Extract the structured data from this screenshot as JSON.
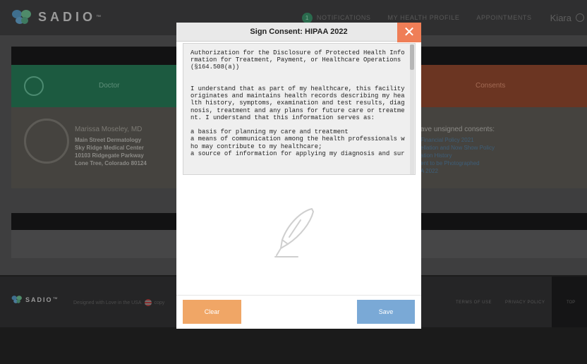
{
  "brand": {
    "name": "SADIO",
    "tm": "™"
  },
  "nav": {
    "notification_count": "1",
    "notifications": "NOTIFICATIONS",
    "health_profile": "MY HEALTH PROFILE",
    "appointments": "APPOINTMENTS",
    "user": "Kiara"
  },
  "cards": {
    "doctor_label": "Doctor",
    "consents_label": "Consents"
  },
  "doctor": {
    "name": "Marissa Moseley, MD",
    "practice": "Main Street Dermatology",
    "center": "Sky Ridge Medical Center",
    "street": "10103 Ridgegate Parkway",
    "city": "Lone Tree, Colorado 80124"
  },
  "consents": {
    "title": "ave unsigned consents:",
    "items": [
      "Financial Policy 2021",
      "ellation and Now Show Policy",
      "ation History",
      "ent to be Photographed",
      "A 2022"
    ]
  },
  "footer": {
    "designed": "Designed with Love in the USA",
    "copyright": "copy",
    "terms": "TERMS OF USE",
    "privacy": "PRIVACY POLICY",
    "top": "TOP"
  },
  "modal": {
    "title": "Sign Consent: HIPAA 2022",
    "close": "✕",
    "text": "Authorization for the Disclosure of Protected Health Information for Treatment, Payment, or Healthcare Operations (§164.508(a))\n\n\nI understand that as part of my healthcare, this facility originates and maintains health records describing my health history, symptoms, examination and test results, diagnosis, treatment and any plans for future care or treatment. I understand that this information serves as:\n\na basis for planning my care and treatment\na means of communication among the health professionals who may contribute to my healthcare;\na source of information for applying my diagnosis and sur",
    "clear": "Clear",
    "save": "Save"
  },
  "icons": {
    "logo": "sadio-logo-icon",
    "signature": "pen-icon",
    "close": "close-icon",
    "avatar": "avatar-icon"
  },
  "colors": {
    "close_button": "#ef7e57",
    "clear_button": "#f0a666",
    "save_button": "#7aa9d6"
  }
}
